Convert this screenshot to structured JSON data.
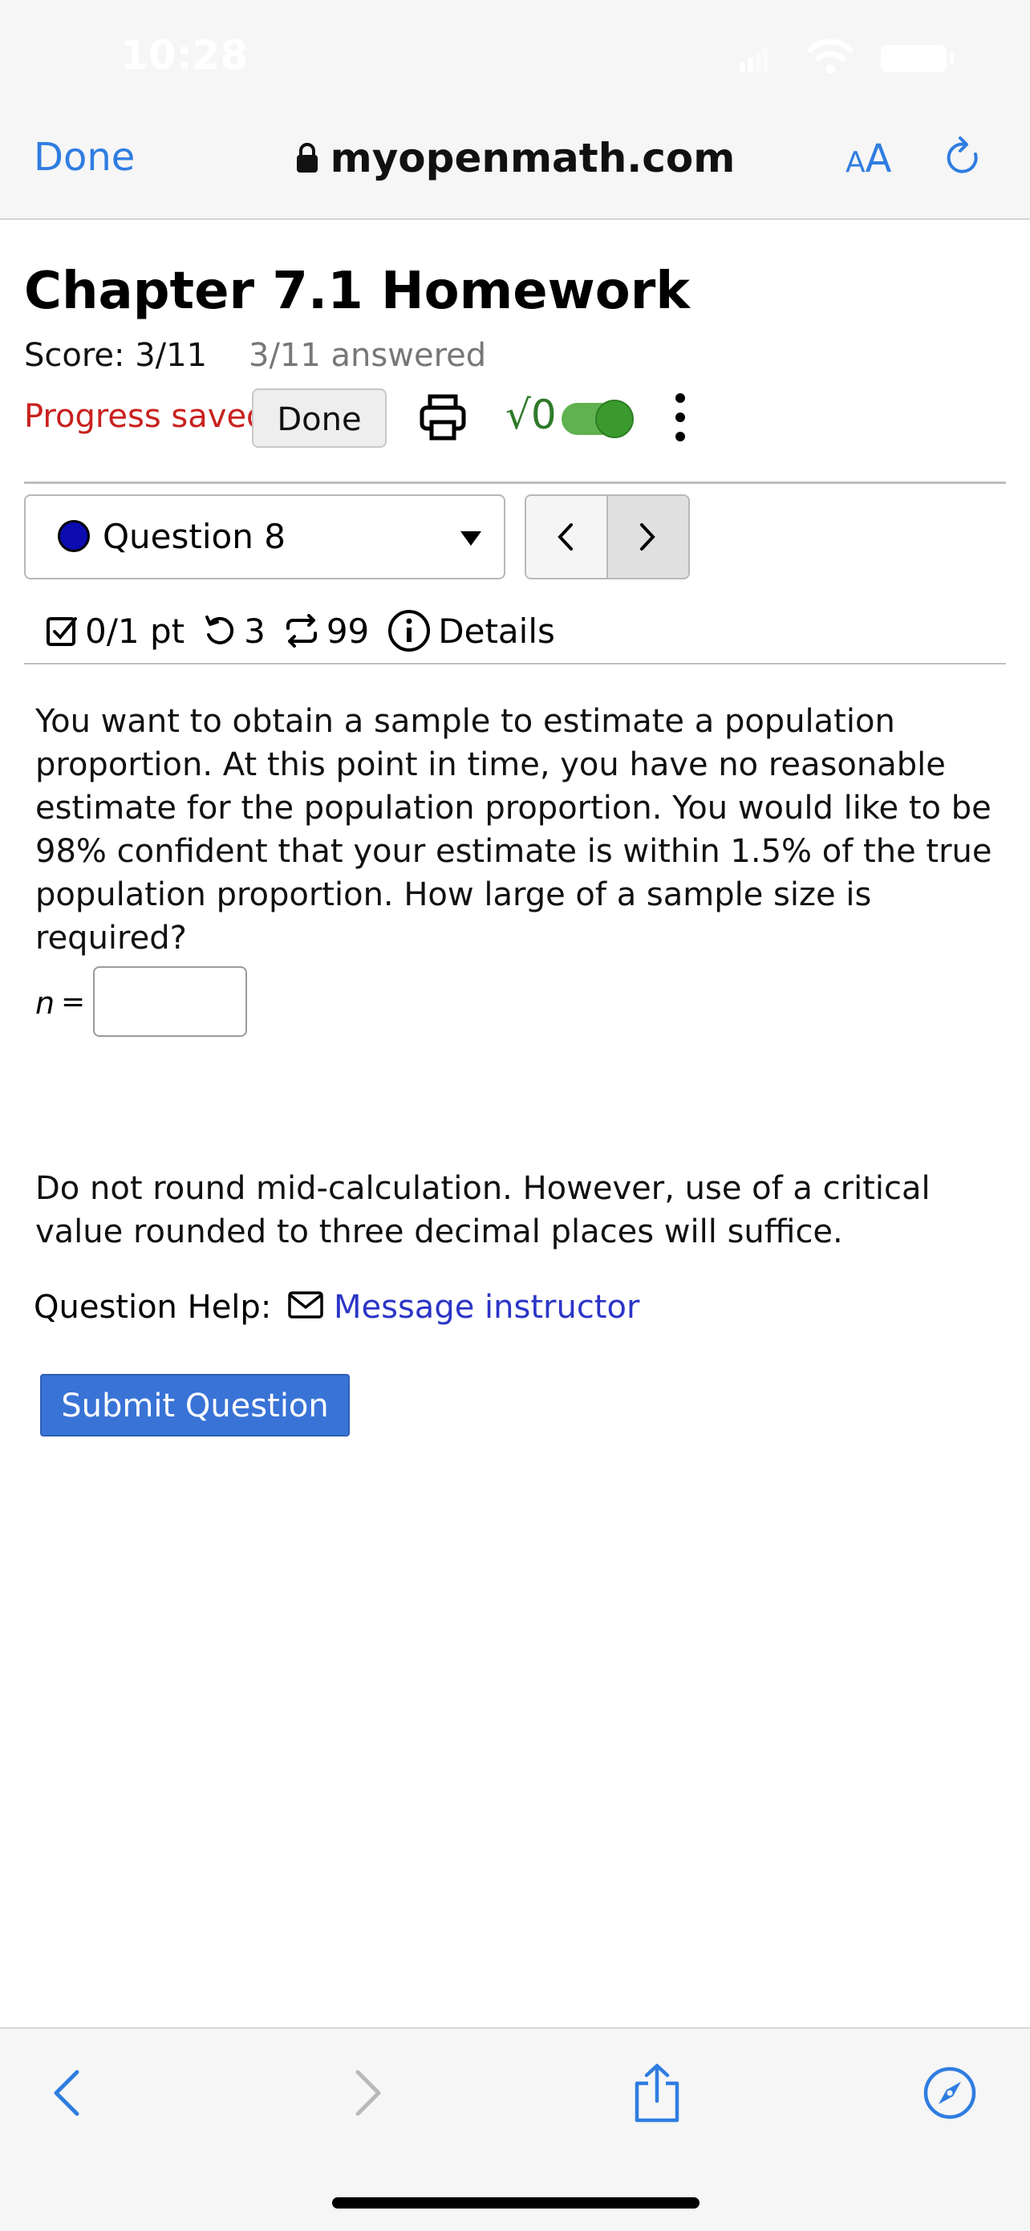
{
  "status_bar": {
    "time": "10:28"
  },
  "browser": {
    "done_label": "Done",
    "url": "myopenmath.com",
    "text_size_label_small": "A",
    "text_size_label_large": "A",
    "accent_color": "#2f7de1"
  },
  "page": {
    "title": "Chapter 7.1 Homework",
    "score": "Score: 3/11",
    "answered": "3/11 answered",
    "progress": "Progress saved",
    "done_button": "Done",
    "math_toggle_symbol": "√0",
    "math_toggle_on": true
  },
  "question_nav": {
    "selected": "Question 8",
    "prev_label": "<",
    "next_label": ">"
  },
  "meta": {
    "points": "0/1 pt",
    "attempts": "3",
    "versions": "99",
    "details": "Details"
  },
  "question": {
    "text": "You want to obtain a sample to estimate a population proportion. At this point in time, you have no reasonable estimate for the population proportion. You would like to be 98% confident that your estimate is within 1.5% of the true population proportion. How large of a sample size is required?",
    "answer_var": "n",
    "answer_eq": "=",
    "answer_value": "",
    "note": "Do not round mid-calculation. However, use of a critical value rounded to three decimal places will suffice.",
    "help_label": "Question Help:",
    "help_link": "Message instructor",
    "submit_label": "Submit Question"
  }
}
